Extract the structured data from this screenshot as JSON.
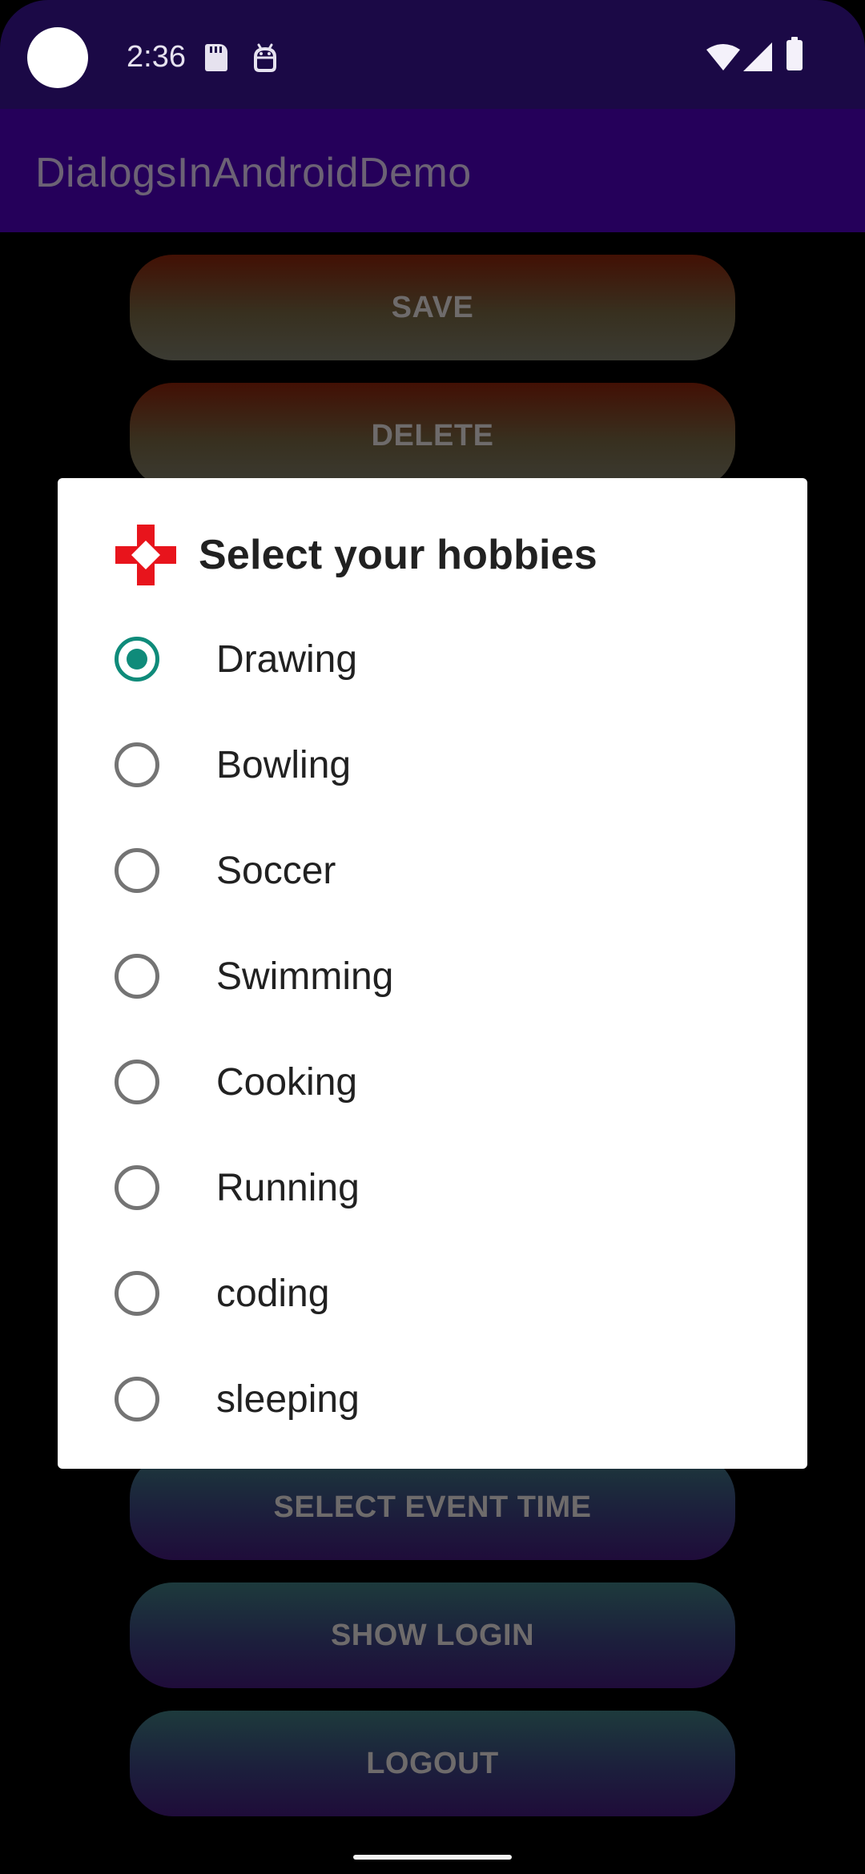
{
  "status_bar": {
    "time": "2:36",
    "icons": [
      "camera-hole",
      "sd-card-icon",
      "android-icon",
      "wifi-icon",
      "signal-icon",
      "battery-icon"
    ]
  },
  "app_bar": {
    "title": "DialogsInAndroidDemo"
  },
  "buttons": {
    "save": "SAVE",
    "delete": "DELETE",
    "select_event_time": "SELECT EVENT TIME",
    "show_login": "SHOW LOGIN",
    "logout": "LOGOUT"
  },
  "dialog": {
    "icon": "red-cross-icon",
    "title": "Select your hobbies",
    "selected_index": 0,
    "options": [
      {
        "label": "Drawing",
        "checked": true
      },
      {
        "label": "Bowling",
        "checked": false
      },
      {
        "label": "Soccer",
        "checked": false
      },
      {
        "label": "Swimming",
        "checked": false
      },
      {
        "label": "Cooking",
        "checked": false
      },
      {
        "label": "Running",
        "checked": false
      },
      {
        "label": "coding",
        "checked": false
      },
      {
        "label": "sleeping",
        "checked": false
      }
    ]
  },
  "colors": {
    "status_bar": "#1b0946",
    "app_bar": "#25005a",
    "radio_checked": "#0f8b7a",
    "icon_red": "#e8141c"
  }
}
